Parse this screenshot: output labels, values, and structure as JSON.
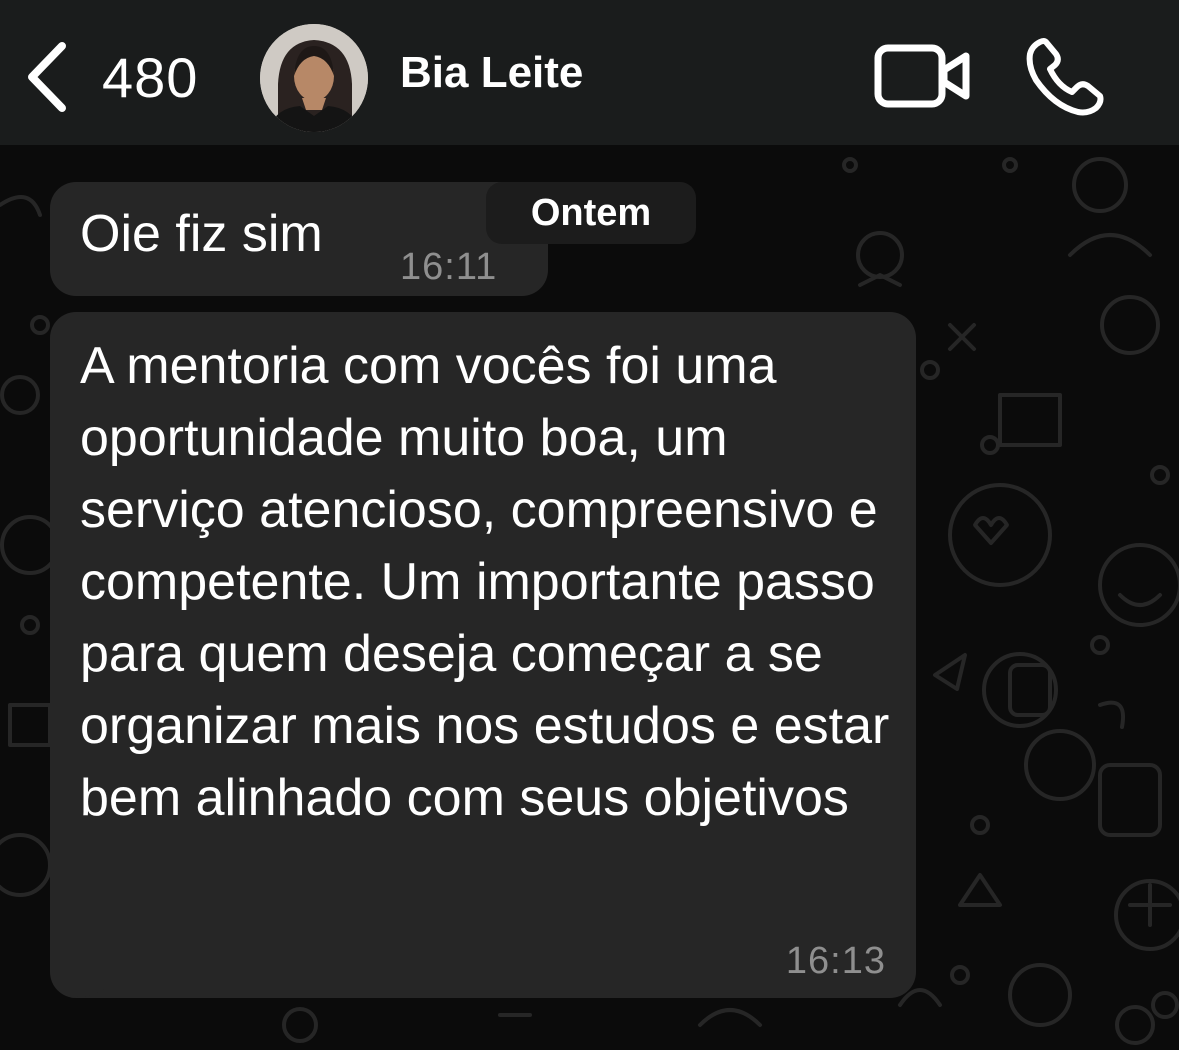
{
  "header": {
    "back_count": "480",
    "contact_name": "Bia Leite",
    "back_icon": "chevron-left-icon",
    "video_icon": "video-camera-icon",
    "call_icon": "phone-icon"
  },
  "date_separator": "Ontem",
  "messages": [
    {
      "text": "Oie fiz sim",
      "time": "16:11",
      "direction": "incoming"
    },
    {
      "text": "A mentoria com vocês foi uma oportunidade muito boa, um serviço atencioso, compreensivo e competente. Um importante passo para quem deseja começar a se organizar mais nos estudos e estar bem alinhado com seus objetivos",
      "time": "16:13",
      "direction": "incoming"
    }
  ],
  "colors": {
    "header_bg": "#1a1c1c",
    "wallpaper_bg": "#0b0b0b",
    "bubble_bg": "#262626",
    "timestamp": "#8f8f8f"
  }
}
